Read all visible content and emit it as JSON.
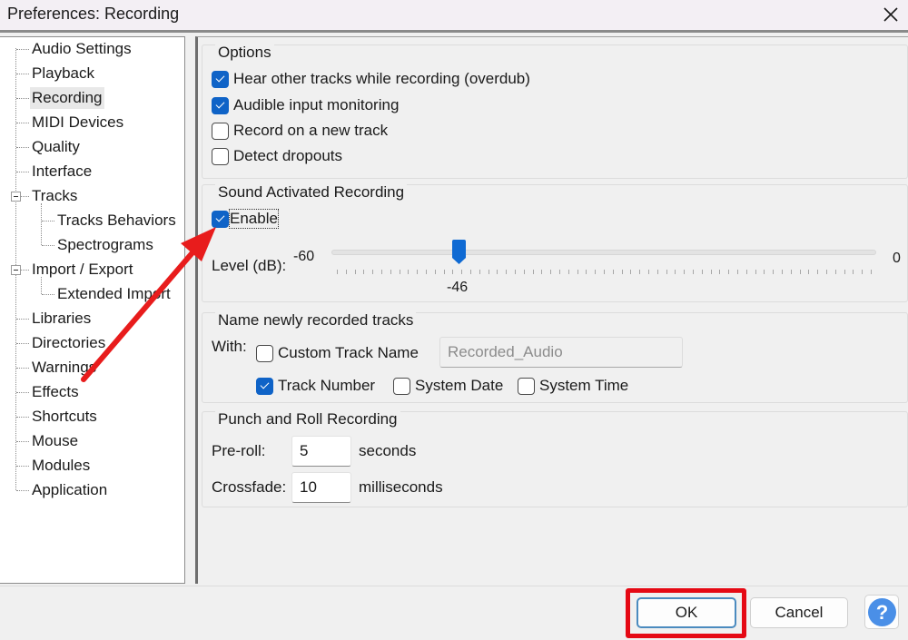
{
  "window": {
    "title": "Preferences: Recording",
    "close_icon": "close-icon"
  },
  "tree": {
    "items": [
      {
        "label": "Audio Settings",
        "level": 0
      },
      {
        "label": "Playback",
        "level": 0
      },
      {
        "label": "Recording",
        "level": 0,
        "selected": true
      },
      {
        "label": "MIDI Devices",
        "level": 0
      },
      {
        "label": "Quality",
        "level": 0
      },
      {
        "label": "Interface",
        "level": 0
      },
      {
        "label": "Tracks",
        "level": 0,
        "expanded": true
      },
      {
        "label": "Tracks Behaviors",
        "level": 1
      },
      {
        "label": "Spectrograms",
        "level": 1
      },
      {
        "label": "Import / Export",
        "level": 0,
        "expanded": true
      },
      {
        "label": "Extended Import",
        "level": 1
      },
      {
        "label": "Libraries",
        "level": 0
      },
      {
        "label": "Directories",
        "level": 0
      },
      {
        "label": "Warnings",
        "level": 0
      },
      {
        "label": "Effects",
        "level": 0
      },
      {
        "label": "Shortcuts",
        "level": 0
      },
      {
        "label": "Mouse",
        "level": 0
      },
      {
        "label": "Modules",
        "level": 0
      },
      {
        "label": "Application",
        "level": 0
      }
    ]
  },
  "options": {
    "title": "Options",
    "items": [
      {
        "label": "Hear other tracks while recording (overdub)",
        "checked": true
      },
      {
        "label": "Audible input monitoring",
        "checked": true
      },
      {
        "label": "Record on a new track",
        "checked": false
      },
      {
        "label": "Detect dropouts",
        "checked": false
      }
    ]
  },
  "sound_activated": {
    "title": "Sound Activated Recording",
    "enable_label": "Enable",
    "enable_checked": true,
    "level_label": "Level (dB):",
    "min_label": "-60",
    "max_label": "0",
    "min": -60,
    "max": 0,
    "value": -46,
    "value_label": "-46"
  },
  "naming": {
    "title": "Name newly recorded tracks",
    "with_label": "With:",
    "custom_track_name": {
      "label": "Custom Track Name",
      "checked": false
    },
    "custom_name_value": "Recorded_Audio",
    "track_number": {
      "label": "Track Number",
      "checked": true
    },
    "system_date": {
      "label": "System Date",
      "checked": false
    },
    "system_time": {
      "label": "System Time",
      "checked": false
    }
  },
  "punch_roll": {
    "title": "Punch and Roll Recording",
    "preroll_label": "Pre-roll:",
    "preroll_value": "5",
    "preroll_unit": "seconds",
    "crossfade_label": "Crossfade:",
    "crossfade_value": "10",
    "crossfade_unit": "milliseconds"
  },
  "buttons": {
    "ok": "OK",
    "cancel": "Cancel",
    "help": "?"
  },
  "annotations": {
    "arrow_color": "#e81c1c",
    "highlight_color": "#e50914"
  }
}
